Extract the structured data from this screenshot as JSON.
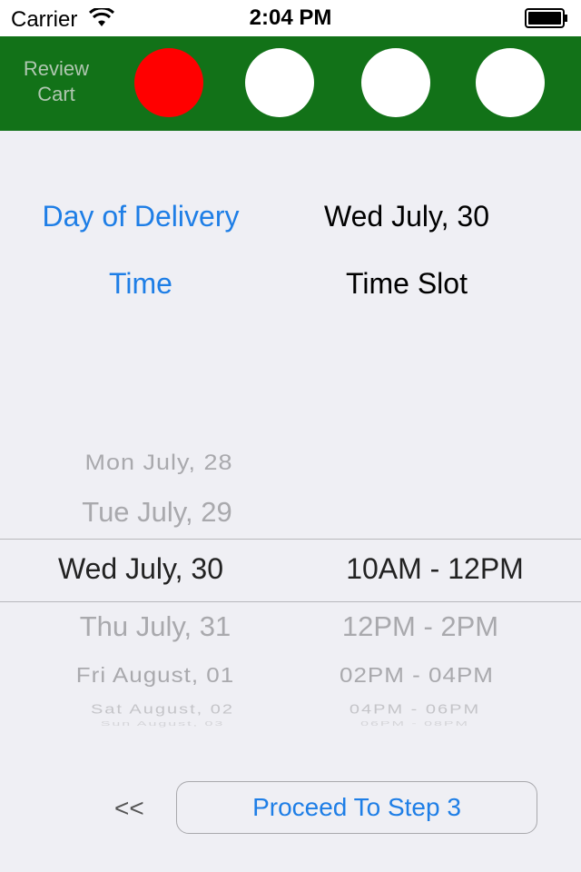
{
  "status_bar": {
    "carrier": "Carrier",
    "time": "2:04 PM",
    "icons": [
      "wifi-icon",
      "battery-icon"
    ]
  },
  "steps": {
    "review_label_line1": "Review",
    "review_label_line2": "Cart",
    "colors": {
      "bar": "#127218",
      "active": "#ff0000",
      "inactive": "#ffffff"
    }
  },
  "delivery": {
    "day_label": "Day of Delivery",
    "day_value": "Wed July, 30",
    "time_label": "Time",
    "time_value": "Time Slot"
  },
  "picker": {
    "days": [
      "Mon July, 28",
      "Tue July, 29",
      "Wed July, 30",
      "Thu July, 31",
      "Fri August, 01",
      "Sat August, 02",
      "Sun August, 03"
    ],
    "slots": [
      "10AM - 12PM",
      "12PM - 2PM",
      "02PM - 04PM",
      "04PM - 06PM",
      "06PM - 08PM"
    ],
    "selected_day": "Wed July, 30",
    "selected_slot": "10AM - 12PM"
  },
  "footer": {
    "back_label": "<<",
    "proceed_label": "Proceed To Step 3"
  },
  "accent_color": "#1e7ee6"
}
